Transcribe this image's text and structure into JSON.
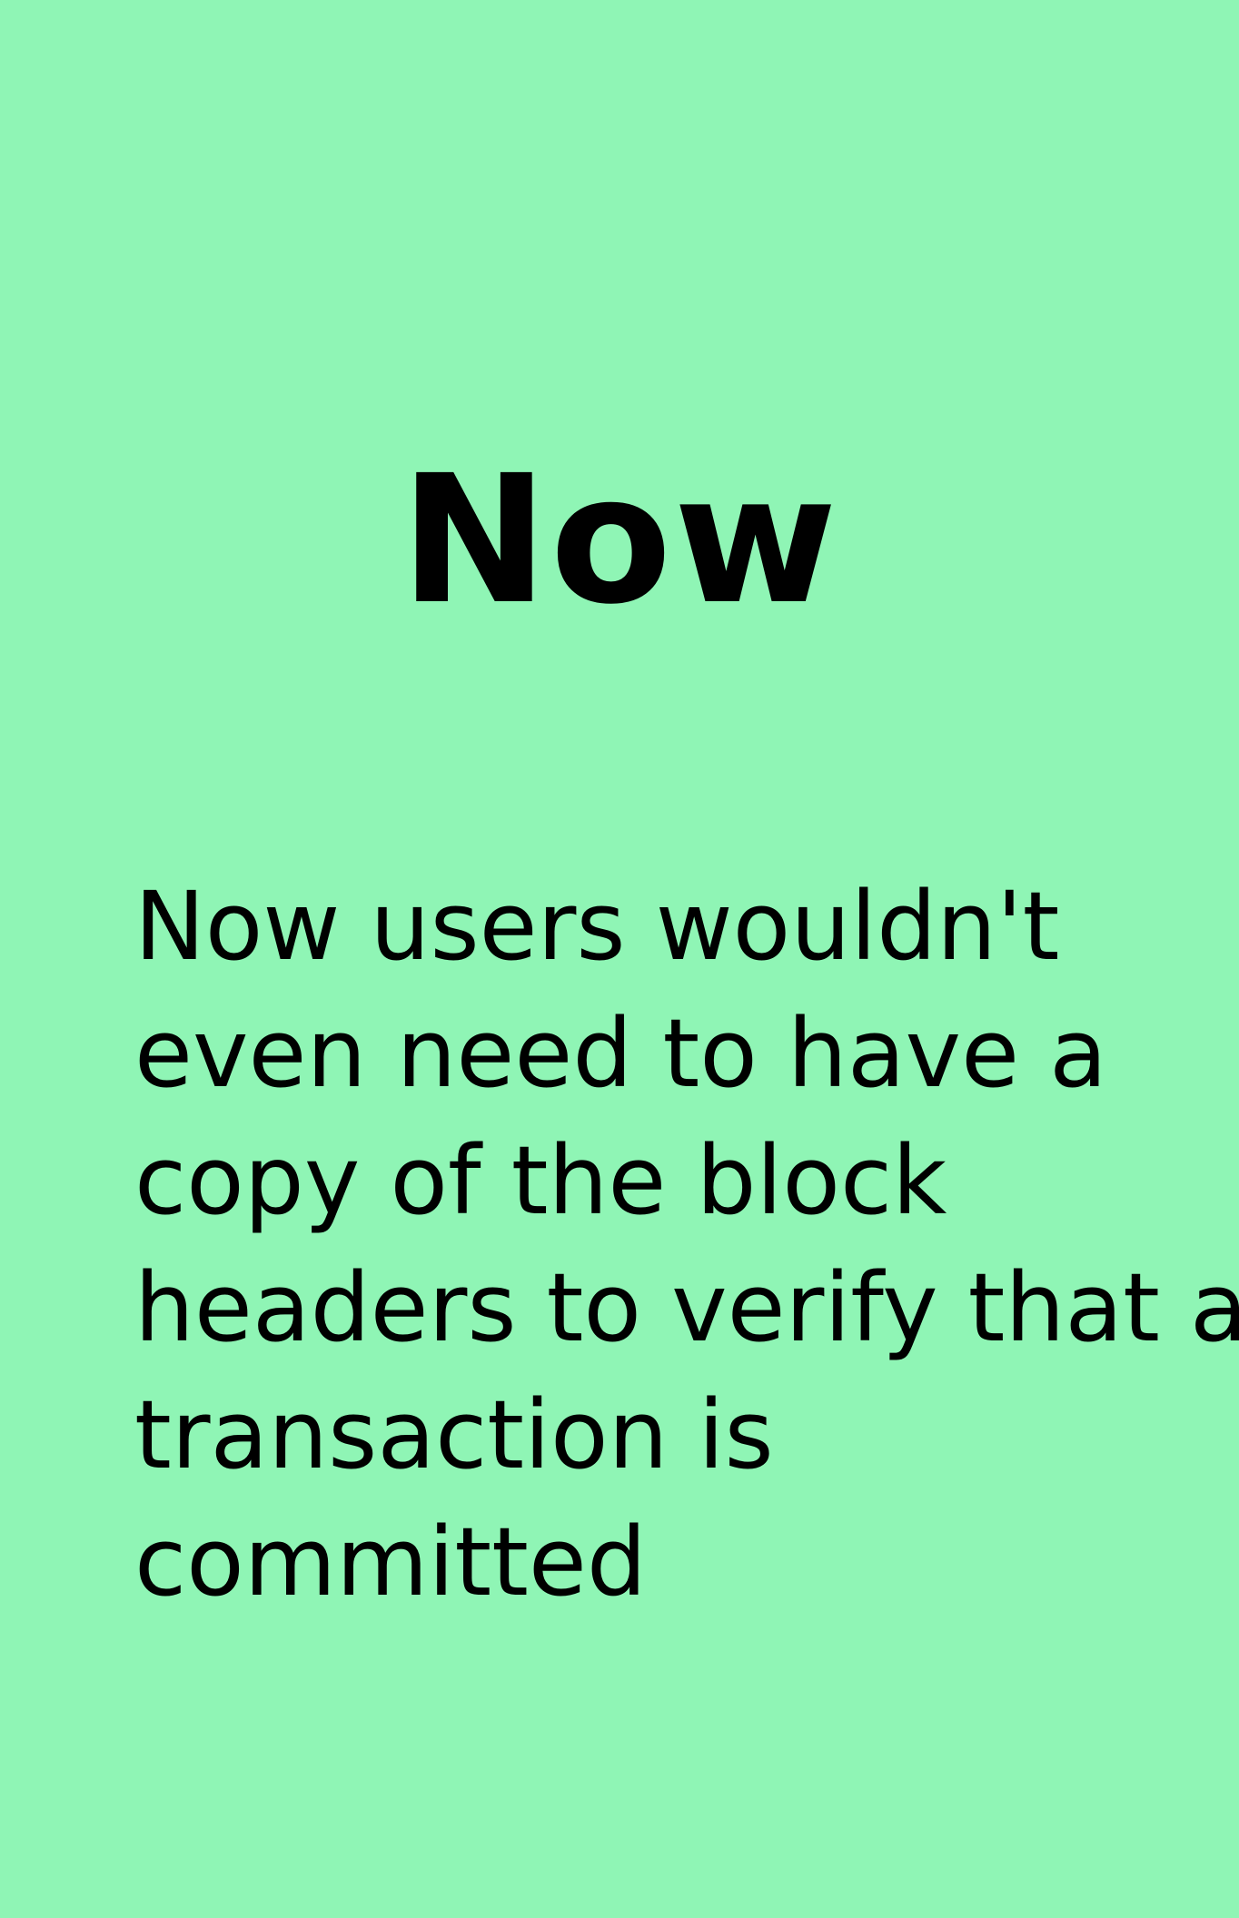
{
  "slide": {
    "background_color": "#8ff5b5",
    "title": "Now",
    "body_lines": [
      "Now users wouldn't",
      "even need to have a",
      "copy of the block",
      "headers to verify that a",
      "transaction is",
      "committed"
    ]
  }
}
